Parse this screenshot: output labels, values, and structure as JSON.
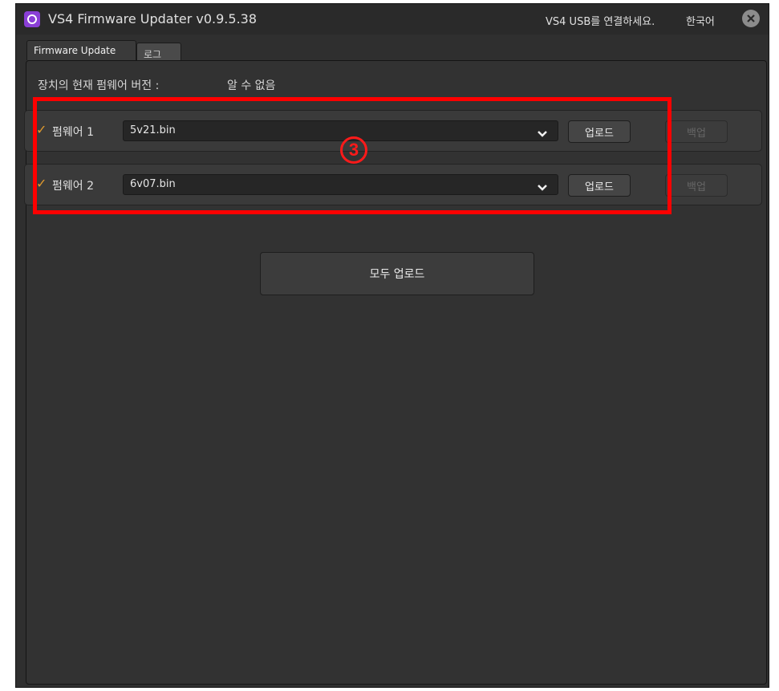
{
  "window": {
    "title": "VS4 Firmware Updater v0.9.5.38",
    "status": "VS4 USB를 연결하세요.",
    "language": "한국어",
    "app_icon": "app-logo-icon",
    "close_icon": "close-icon"
  },
  "tabs": [
    {
      "label": "Firmware Update",
      "active": true
    },
    {
      "label": "로그",
      "active": false
    }
  ],
  "device": {
    "version_label": "장치의 현재 펌웨어 버전 :",
    "version_value": "알 수 없음"
  },
  "firmware": [
    {
      "label": "펌웨어 1",
      "checked": true,
      "file": "5v21.bin",
      "upload_label": "업로드",
      "backup_label": "백업",
      "backup_enabled": false
    },
    {
      "label": "펌웨어 2",
      "checked": true,
      "file": "6v07.bin",
      "upload_label": "업로드",
      "backup_label": "백업",
      "backup_enabled": false
    }
  ],
  "upload_all_label": "모두 업로드",
  "annotation": {
    "marker": "3",
    "color": "#ff0000"
  },
  "colors": {
    "check": "#e09a2e",
    "background": "#2f2f2f"
  }
}
